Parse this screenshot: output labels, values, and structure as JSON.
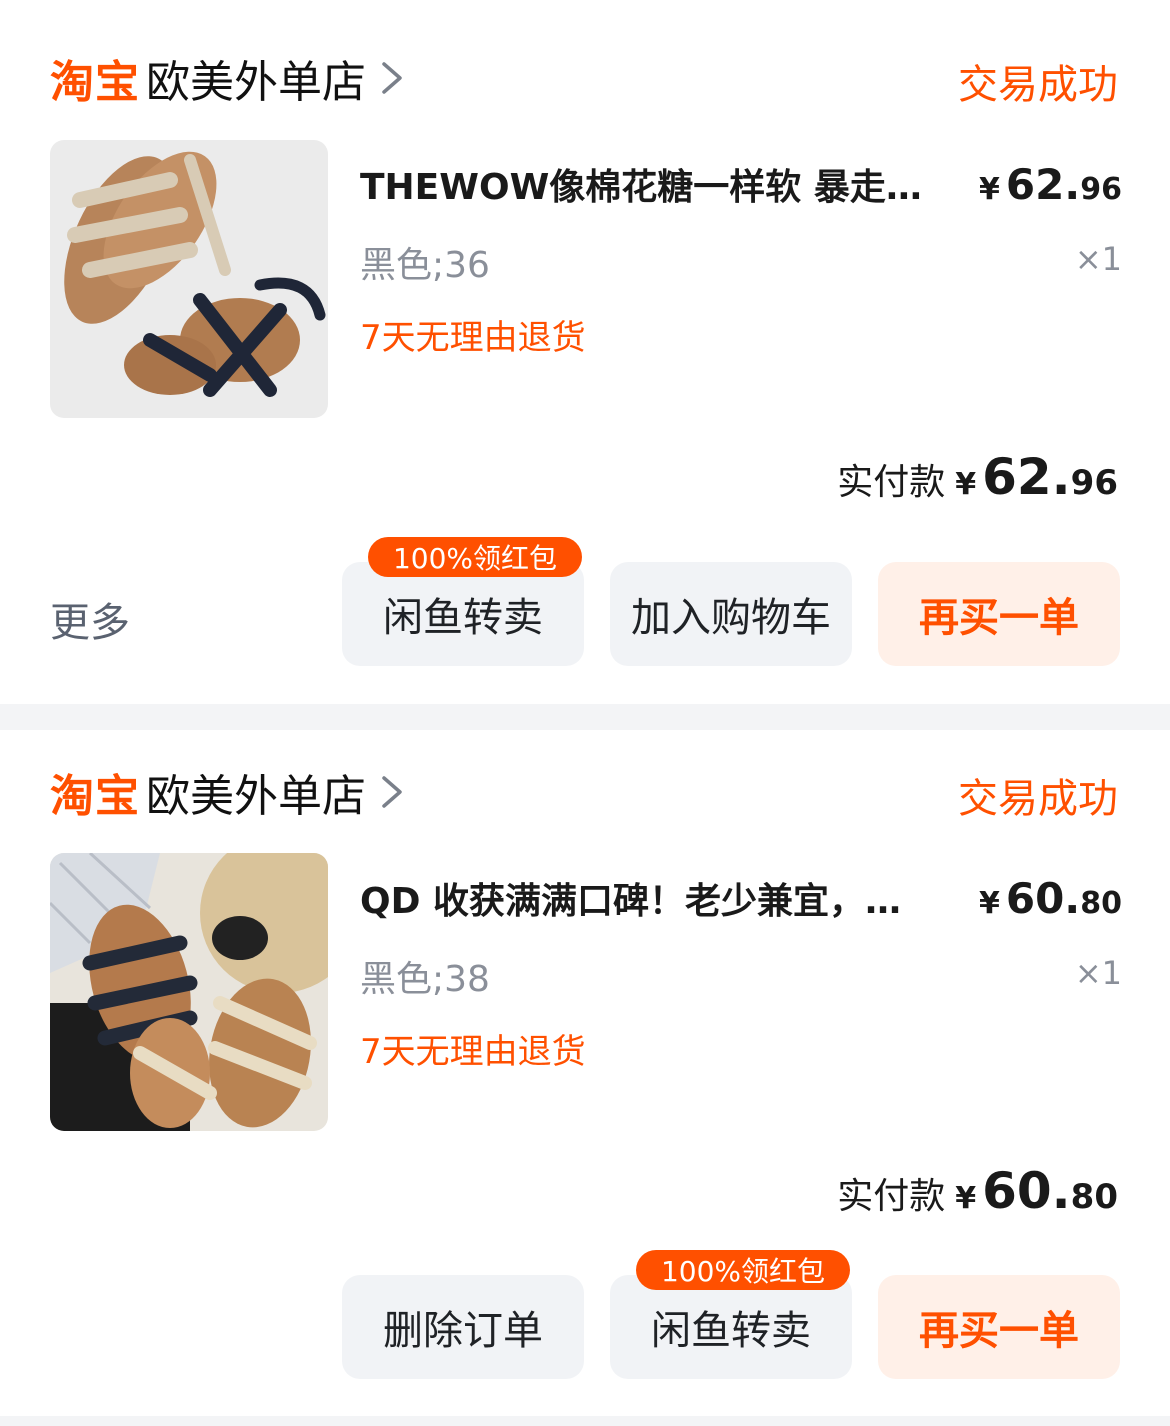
{
  "orders": [
    {
      "platform_logo": "淘宝",
      "shop_name": "欧美外单店",
      "status": "交易成功",
      "product_title": "THEWOW像棉花糖一样软 暴走…",
      "price_currency": "¥",
      "price_int": "62.",
      "price_dec": "96",
      "sku": "黑色;36",
      "quantity": "×1",
      "return_policy": "7天无理由退货",
      "paid_label": "实付款",
      "paid_currency": "¥",
      "paid_int": "62.",
      "paid_dec": "96",
      "more_label": "更多",
      "buttons": [
        {
          "label": "闲鱼转卖",
          "badge": "100%领红包"
        },
        {
          "label": "加入购物车"
        },
        {
          "label": "再买一单"
        }
      ]
    },
    {
      "platform_logo": "淘宝",
      "shop_name": "欧美外单店",
      "status": "交易成功",
      "product_title": "QD 收获满满口碑！老少兼宜，…",
      "price_currency": "¥",
      "price_int": "60.",
      "price_dec": "80",
      "sku": "黑色;38",
      "quantity": "×1",
      "return_policy": "7天无理由退货",
      "paid_label": "实付款",
      "paid_currency": "¥",
      "paid_int": "60.",
      "paid_dec": "80",
      "buttons": [
        {
          "label": "删除订单"
        },
        {
          "label": "闲鱼转卖",
          "badge": "100%领红包"
        },
        {
          "label": "再买一单"
        }
      ]
    }
  ],
  "colors": {
    "accent": "#ff5000",
    "secondary_text": "#8a8f99",
    "button_bg": "#f1f3f6",
    "primary_button_bg": "#fff0e8"
  },
  "icons": [
    "chevron-right-icon",
    "sandal-product-image"
  ]
}
